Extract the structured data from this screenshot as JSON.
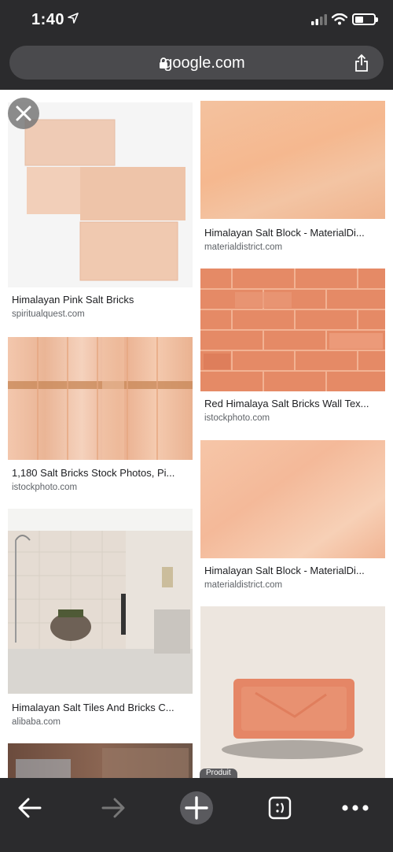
{
  "status_bar": {
    "time": "1:40"
  },
  "url_bar": {
    "domain": "google.com"
  },
  "results": [
    {
      "title": "Himalayan Pink Salt Bricks",
      "domain": "spiritualquest.com"
    },
    {
      "title": "Himalayan Salt Block - MaterialDi...",
      "domain": "materialdistrict.com"
    },
    {
      "title": "Red Himalaya Salt Bricks Wall Tex...",
      "domain": "istockphoto.com"
    },
    {
      "title": "1,180 Salt Bricks Stock Photos, Pi...",
      "domain": "istockphoto.com"
    },
    {
      "title": "Himalayan Salt Block - MaterialDi...",
      "domain": "materialdistrict.com"
    },
    {
      "title": "Himalayan Salt Tiles And Bricks C...",
      "domain": "alibaba.com"
    }
  ],
  "product_badge": "Produit",
  "colors": {
    "chrome_bg": "#2b2b2d",
    "urlbar_bg": "#4a4a4d",
    "salt_pink": "#f1b08e",
    "salt_red": "#e07f5c"
  },
  "icons": [
    "location-arrow-icon",
    "cellular-signal-icon",
    "wifi-icon",
    "battery-icon",
    "lock-icon",
    "share-icon",
    "close-icon",
    "back-icon",
    "forward-icon",
    "new-tab-plus-icon",
    "tab-switcher-icon",
    "more-icon"
  ]
}
